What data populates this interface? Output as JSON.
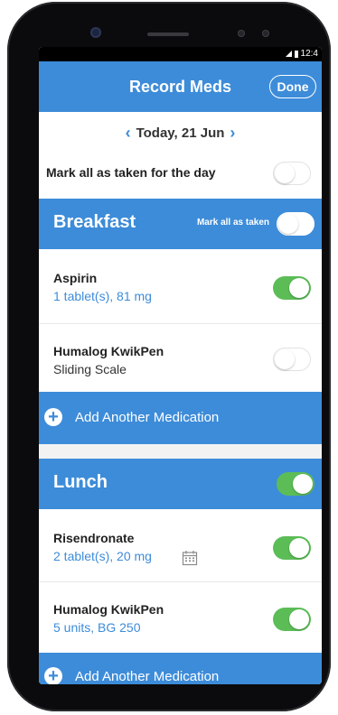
{
  "status": {
    "time": "12:4"
  },
  "header": {
    "title": "Record Meds",
    "done_label": "Done"
  },
  "date": {
    "label": "Today, 21 Jun"
  },
  "mark_all_day": {
    "label": "Mark all as taken for the day",
    "on": false
  },
  "sections": [
    {
      "title": "Breakfast",
      "mark_all_label": "Mark all as taken",
      "toggle_on": false,
      "meds": [
        {
          "name": "Aspirin",
          "detail": "1 tablet(s), 81 mg",
          "taken": true
        },
        {
          "name": "Humalog KwikPen",
          "detail": "Sliding Scale",
          "taken": false
        }
      ],
      "add_label": "Add Another Medication"
    },
    {
      "title": "Lunch",
      "toggle_on": true,
      "meds": [
        {
          "name": "Risendronate",
          "detail": "2 tablet(s), 20 mg",
          "taken": true,
          "icon": "calendar-icon"
        },
        {
          "name": "Humalog KwikPen",
          "detail": "5 units, BG 250",
          "taken": true
        }
      ],
      "add_label": "Add Another Medication"
    }
  ],
  "colors": {
    "accent": "#3d8cd9",
    "toggle_on": "#5cbd57"
  }
}
